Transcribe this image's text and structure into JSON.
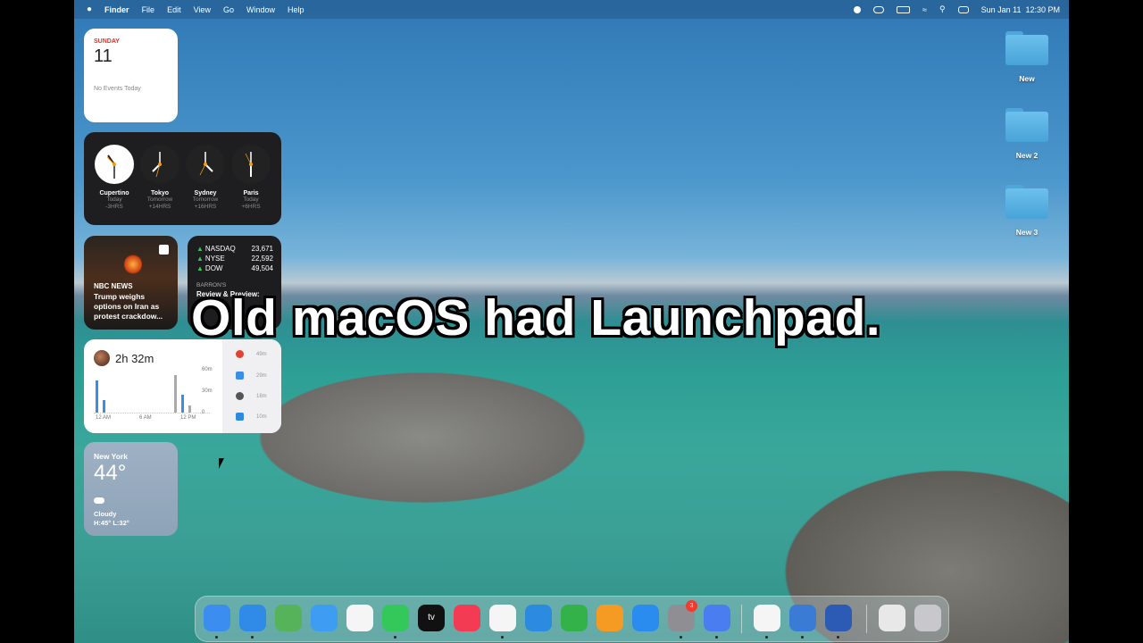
{
  "menubar": {
    "app": "Finder",
    "menus": [
      "File",
      "Edit",
      "View",
      "Go",
      "Window",
      "Help"
    ],
    "datetime": "Sun Jan 11  12:30 PM"
  },
  "calendar": {
    "weekday": "SUNDAY",
    "date": "11",
    "events": "No Events Today"
  },
  "world_clock": [
    {
      "city": "Cupertino",
      "day": "Today",
      "offset": "-3HRS"
    },
    {
      "city": "Tokyo",
      "day": "Tomorrow",
      "offset": "+14HRS"
    },
    {
      "city": "Sydney",
      "day": "Tomorrow",
      "offset": "+16HRS"
    },
    {
      "city": "Paris",
      "day": "Today",
      "offset": "+6HRS"
    }
  ],
  "news": {
    "source": "NBC NEWS",
    "headline": "Trump weighs options on Iran as protest crackdow..."
  },
  "stocks": {
    "rows": [
      {
        "symbol": "NASDAQ",
        "value": "23,671"
      },
      {
        "symbol": "NYSE",
        "value": "22,592"
      },
      {
        "symbol": "DOW",
        "value": "49,504"
      }
    ],
    "source": "BARRON'S",
    "headline": "Review & Preview:"
  },
  "screen_time": {
    "total": "2h 32m",
    "y_ticks": [
      "60m",
      "30m",
      "0"
    ],
    "x_ticks": [
      "12 AM",
      "6 AM",
      "12 PM"
    ],
    "apps": [
      {
        "time": "49m",
        "color": "#e34133"
      },
      {
        "time": "29m",
        "color": "#3a8ee6"
      },
      {
        "time": "18m",
        "color": "#555555"
      },
      {
        "time": "10m",
        "color": "#2a8be0"
      }
    ]
  },
  "weather": {
    "city": "New York",
    "temp": "44°",
    "condition": "Cloudy",
    "hilo": "H:45° L:32°"
  },
  "desktop_folders": [
    "New",
    "New 2",
    "New 3"
  ],
  "caption": "Old macOS had Launchpad.",
  "dock": {
    "apps": [
      {
        "name": "finder-icon",
        "color": "#3b8ef0"
      },
      {
        "name": "safari-icon",
        "color": "#2f8ae8"
      },
      {
        "name": "maps-icon",
        "color": "#56b35a"
      },
      {
        "name": "mail-icon",
        "color": "#3e9cf2"
      },
      {
        "name": "reminders-icon",
        "color": "#f5f5f5"
      },
      {
        "name": "messages-icon",
        "color": "#34c759"
      },
      {
        "name": "tv-icon",
        "color": "#111111"
      },
      {
        "name": "music-icon",
        "color": "#f43b54"
      },
      {
        "name": "news-icon",
        "color": "#f5f5f5"
      },
      {
        "name": "keynote-icon",
        "color": "#2c8be0"
      },
      {
        "name": "numbers-icon",
        "color": "#34b24a"
      },
      {
        "name": "pages-icon",
        "color": "#f59a23"
      },
      {
        "name": "appstore-icon",
        "color": "#2b8cf0"
      },
      {
        "name": "settings-icon",
        "color": "#8e8e93"
      },
      {
        "name": "iphone-mirroring-icon",
        "color": "#4a7ef0"
      },
      {
        "name": "chrome-icon",
        "color": "#f5f5f5"
      },
      {
        "name": "quicktime-icon",
        "color": "#3a7bd5"
      },
      {
        "name": "app-icon",
        "color": "#2b5bb5"
      },
      {
        "name": "preview-icon",
        "color": "#e8e8e8"
      },
      {
        "name": "trash-icon",
        "color": "#c8c8cc"
      }
    ],
    "settings_badge": "3",
    "tv_label": "tv"
  }
}
